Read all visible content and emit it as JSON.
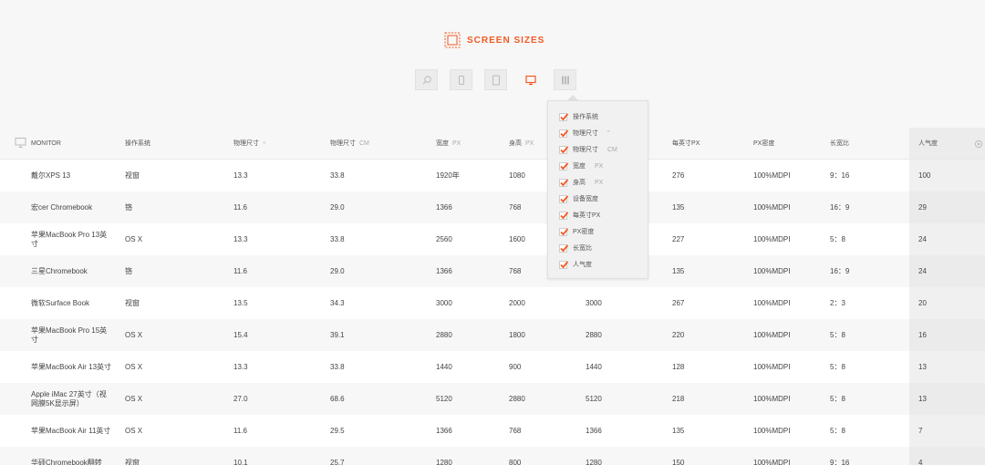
{
  "brand": {
    "title": "SCREEN SIZES",
    "accent": "#f15a22"
  },
  "toolbar": {
    "buttons": [
      {
        "name": "search",
        "icon": "search-icon",
        "active": false
      },
      {
        "name": "phone",
        "icon": "phone-icon",
        "active": false
      },
      {
        "name": "tablet",
        "icon": "tablet-icon",
        "active": false
      },
      {
        "name": "monitor",
        "icon": "monitor-icon",
        "active": true
      },
      {
        "name": "columns",
        "icon": "columns-icon",
        "active": false
      }
    ]
  },
  "table": {
    "headers": {
      "device": "MONITOR",
      "os": "操作系统",
      "size_in": "物理尺寸",
      "size_cm": "物理尺寸",
      "size_cm_unit": "CM",
      "width": "宽度",
      "width_unit": "PX",
      "height": "身高",
      "height_unit": "PX",
      "dev_width": "",
      "ppi": "每英寸PX",
      "density": "PX密度",
      "ratio": "长宽比",
      "popularity": "人气度"
    },
    "rows": [
      {
        "device": "戴尔XPS 13",
        "os": "视窗",
        "size_in": "13.3",
        "size_cm": "33.8",
        "width": "1920年",
        "height": "1080",
        "dev_width": "",
        "ppi": "276",
        "density": "100%MDPI",
        "ratio": "9：16",
        "popularity": "100"
      },
      {
        "device": "宏cer Chromebook",
        "os": "铬",
        "size_in": "11.6",
        "size_cm": "29.0",
        "width": "1366",
        "height": "768",
        "dev_width": "",
        "ppi": "135",
        "density": "100%MDPI",
        "ratio": "16：9",
        "popularity": "29"
      },
      {
        "device": "苹果MacBook Pro 13英寸",
        "os": "OS X",
        "size_in": "13.3",
        "size_cm": "33.8",
        "width": "2560",
        "height": "1600",
        "dev_width": "",
        "ppi": "227",
        "density": "100%MDPI",
        "ratio": "5：8",
        "popularity": "24"
      },
      {
        "device": "三星Chromebook",
        "os": "铬",
        "size_in": "11.6",
        "size_cm": "29.0",
        "width": "1366",
        "height": "768",
        "dev_width": "",
        "ppi": "135",
        "density": "100%MDPI",
        "ratio": "16：9",
        "popularity": "24"
      },
      {
        "device": "微软Surface Book",
        "os": "视窗",
        "size_in": "13.5",
        "size_cm": "34.3",
        "width": "3000",
        "height": "2000",
        "dev_width": "3000",
        "ppi": "267",
        "density": "100%MDPI",
        "ratio": "2：3",
        "popularity": "20"
      },
      {
        "device": "苹果MacBook Pro 15英寸",
        "os": "OS X",
        "size_in": "15.4",
        "size_cm": "39.1",
        "width": "2880",
        "height": "1800",
        "dev_width": "2880",
        "ppi": "220",
        "density": "100%MDPI",
        "ratio": "5：8",
        "popularity": "16"
      },
      {
        "device": "苹果MacBook Air 13英寸",
        "os": "OS X",
        "size_in": "13.3",
        "size_cm": "33.8",
        "width": "1440",
        "height": "900",
        "dev_width": "1440",
        "ppi": "128",
        "density": "100%MDPI",
        "ratio": "5：8",
        "popularity": "13"
      },
      {
        "device": "Apple iMac 27英寸（视网膜5K显示屏）",
        "os": "OS X",
        "size_in": "27.0",
        "size_cm": "68.6",
        "width": "5120",
        "height": "2880",
        "dev_width": "5120",
        "ppi": "218",
        "density": "100%MDPI",
        "ratio": "5：8",
        "popularity": "13"
      },
      {
        "device": "苹果MacBook Air 11英寸",
        "os": "OS X",
        "size_in": "11.6",
        "size_cm": "29.5",
        "width": "1366",
        "height": "768",
        "dev_width": "1366",
        "ppi": "135",
        "density": "100%MDPI",
        "ratio": "5：8",
        "popularity": "7"
      },
      {
        "device": "华硕Chromebook翻转",
        "os": "视窗",
        "size_in": "10.1",
        "size_cm": "25.7",
        "width": "1280",
        "height": "800",
        "dev_width": "1280",
        "ppi": "150",
        "density": "100%MDPI",
        "ratio": "9：16",
        "popularity": "4"
      }
    ]
  },
  "dropdown": {
    "items": [
      {
        "label": "操作系统",
        "unit": "",
        "checked": true
      },
      {
        "label": "物理尺寸",
        "unit": "\"",
        "checked": true
      },
      {
        "label": "物理尺寸",
        "unit": "CM",
        "checked": true
      },
      {
        "label": "宽度",
        "unit": "PX",
        "checked": true
      },
      {
        "label": "身高",
        "unit": "PX",
        "checked": true
      },
      {
        "label": "设备宽度",
        "unit": "",
        "checked": true
      },
      {
        "label": "每英寸PX",
        "unit": "",
        "checked": true
      },
      {
        "label": "PX密度",
        "unit": "",
        "checked": true
      },
      {
        "label": "长宽比",
        "unit": "",
        "checked": true
      },
      {
        "label": "人气度",
        "unit": "",
        "checked": true
      }
    ]
  }
}
